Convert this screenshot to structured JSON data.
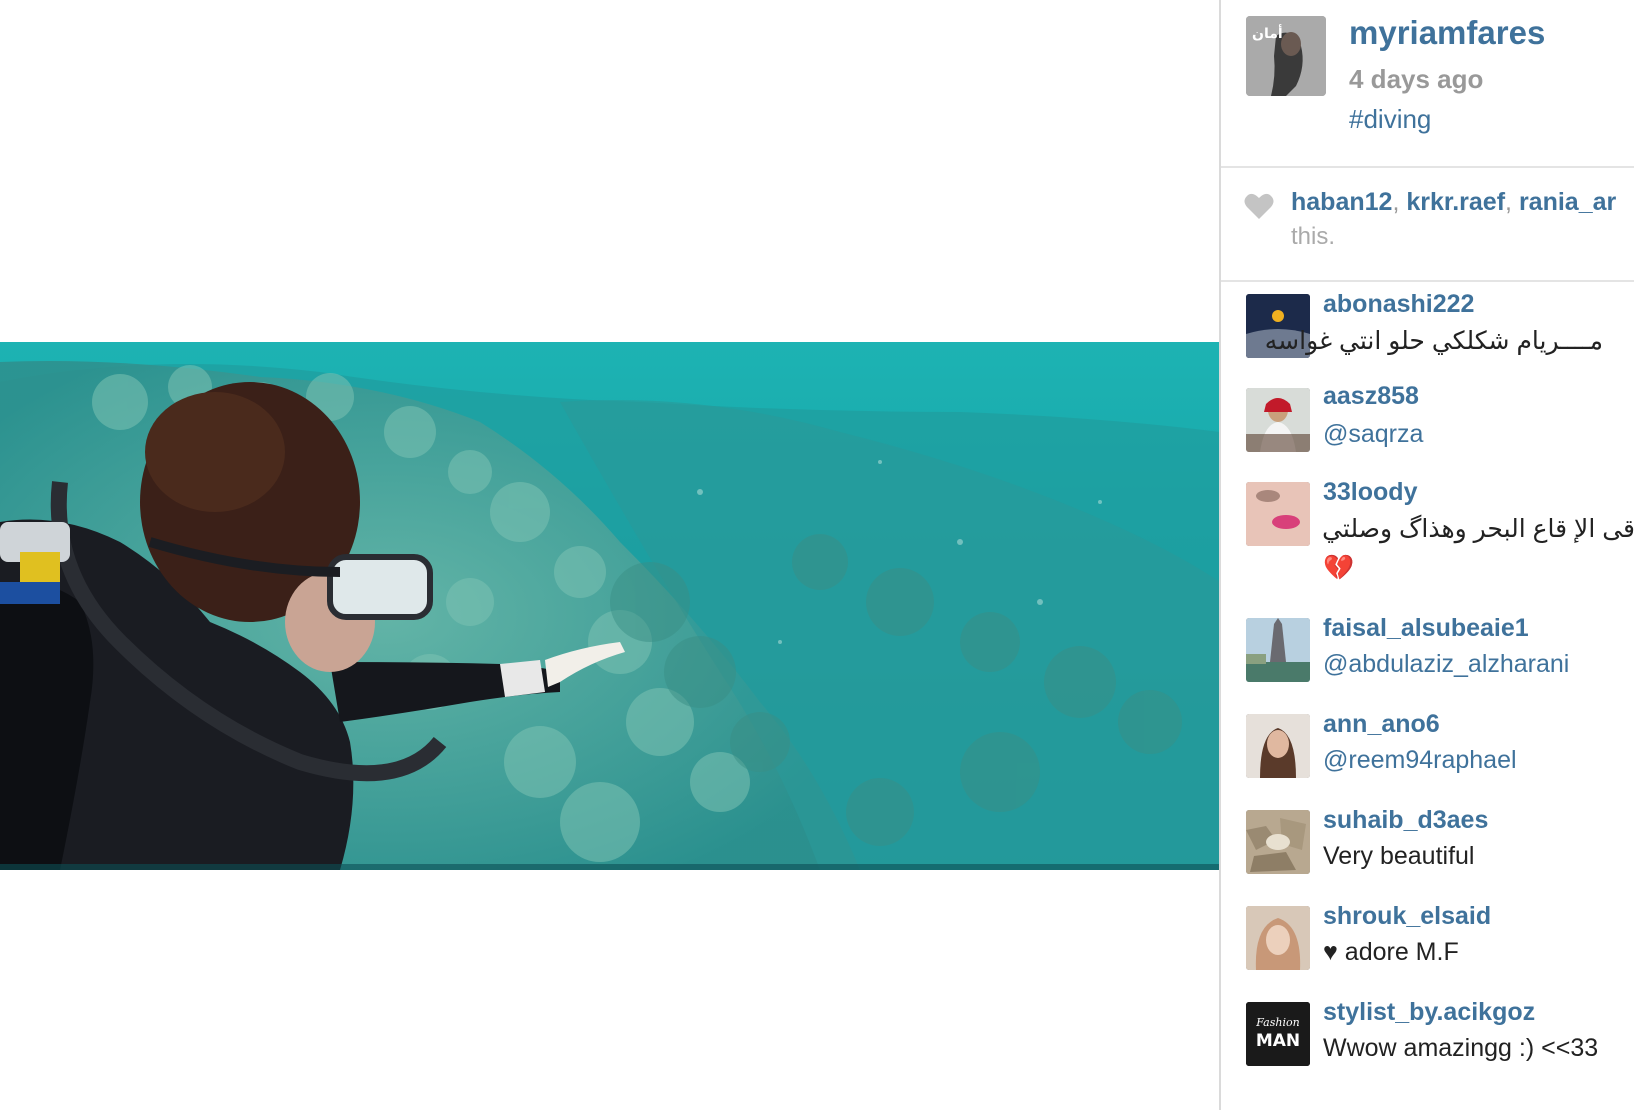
{
  "post": {
    "owner": "myriamfares",
    "time": "4 days ago",
    "caption": "#diving",
    "owner_avatar_text": "أمان"
  },
  "likes": {
    "users": [
      "haban12",
      "krkr.raef",
      "rania_ar"
    ],
    "separator": ",",
    "tail": "this."
  },
  "comments": [
    {
      "user": "abonashi222",
      "text": "مــــريام شكلكي حلو انتي غواسه"
    },
    {
      "user": "aasz858",
      "text": "@saqrza"
    },
    {
      "user": "33loody",
      "text": "قى الإ قاع البحر وهذاگ وصلتي له",
      "text2": "💔"
    },
    {
      "user": "faisal_alsubeaie1",
      "text": "@abdulaziz_alzharani"
    },
    {
      "user": "ann_ano6",
      "text": "@reem94raphael"
    },
    {
      "user": "suhaib_d3aes",
      "text": "Very beautiful"
    },
    {
      "user": "shrouk_elsaid",
      "text": "♥ adore M.F"
    },
    {
      "user": "stylist_by.acikgoz",
      "text": "Wwow amazingg :) <<33",
      "avatar_text_top": "Fashion",
      "avatar_text_bottom": "MAN"
    }
  ],
  "colors": {
    "link": "#3f729b",
    "muted": "#999999",
    "text": "#222222",
    "water": "#17a0a4"
  },
  "icons": {
    "like": "heart-icon"
  }
}
